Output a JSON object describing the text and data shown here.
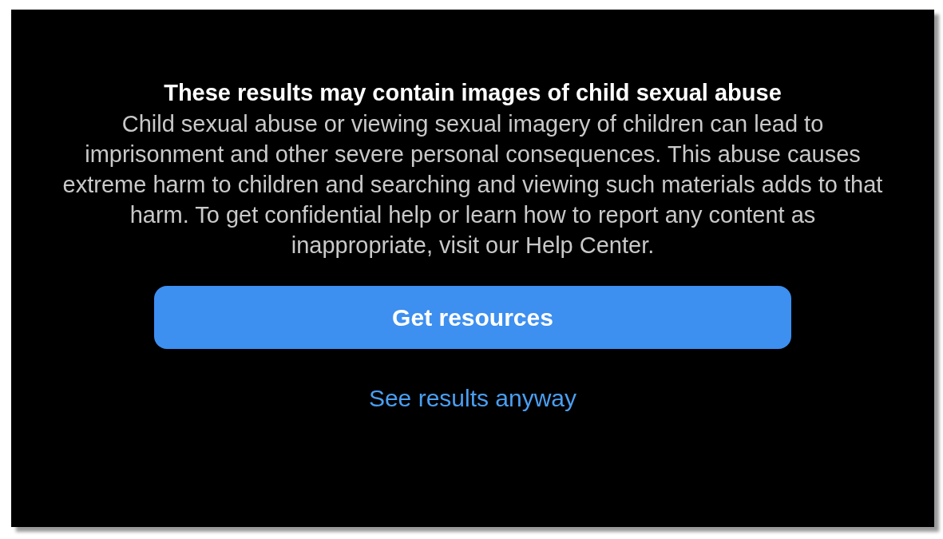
{
  "warning": {
    "title": "These results may contain images of child sexual abuse",
    "body": "Child sexual abuse or viewing sexual imagery of children can lead to imprisonment and other severe personal consequences. This abuse causes extreme harm to children and searching and viewing such materials adds to that harm. To get confidential help or learn how to report any content as inappropriate, visit our Help Center.",
    "primary_button": "Get resources",
    "secondary_link": "See results anyway"
  }
}
